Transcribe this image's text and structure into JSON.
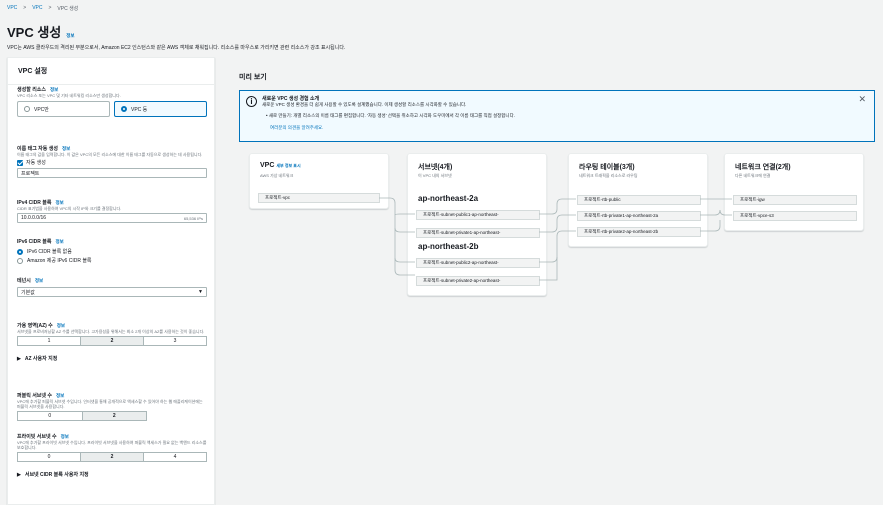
{
  "breadcrumb": {
    "item1": "VPC",
    "sep": ">",
    "item2": "VPC",
    "item3": "VPC 생성"
  },
  "page": {
    "title": "VPC 생성",
    "info": "정보",
    "description": "VPC는 AWS 클라우드의 격리된 부분으로서, Amazon EC2 인스턴스와 같은 AWS 객체로 채워집니다. 리소스를 마우스로 가리키면 관련 리소스가 강조 표시됩니다."
  },
  "settings": {
    "header": "VPC 설정",
    "resources": {
      "label": "생성할 리소스",
      "info": "정보",
      "sub": "VPC 리소스 또는 VPC 및 기타 네트워킹 리소스만 생성합니다.",
      "opt1": "VPC만",
      "opt2": "VPC 등"
    },
    "nametag": {
      "label": "이름 태그 자동 생성",
      "info": "정보",
      "sub": "이름 태그의 값을 입력합니다. 이 값은 VPC의 모든 리소스에 대한 이름 태그를 자동으로 생성하는 데 사용됩니다.",
      "check_label": "자동 생성",
      "value": "프로젝트"
    },
    "ipv4": {
      "label": "IPv4 CIDR 블록",
      "info": "정보",
      "sub": "CIDR 표기법을 사용하여 VPC의 시작 IP와 크기를 결정합니다.",
      "value": "10.0.0.0/16",
      "count": "65,536 IPs"
    },
    "ipv6": {
      "label": "IPv6 CIDR 블록",
      "info": "정보",
      "opt1": "IPv6 CIDR 블록 없음",
      "opt2": "Amazon 제공 IPv6 CIDR 블록"
    },
    "tenancy": {
      "label": "테넌시",
      "info": "정보",
      "value": "기본값"
    },
    "az": {
      "label": "가용 영역(AZ) 수",
      "info": "정보",
      "sub": "서브넷을 프로비저닝할 AZ 수를 선택합니다. 고가용성을 위해서는 최소 2개 이상의 AZ를 사용하는 것이 좋습니다.",
      "options": [
        "1",
        "2",
        "3"
      ],
      "expander": "AZ 사용자 지정"
    },
    "public": {
      "label": "퍼블릭 서브넷 수",
      "info": "정보",
      "sub": "VPC에 추가할 퍼블릭 서브넷 수입니다. 인터넷을 통해 공개적으로 액세스할 수 있어야 하는 웹 애플리케이션에는 퍼블릭 서브넷을 사용합니다.",
      "options": [
        "0",
        "2"
      ]
    },
    "private": {
      "label": "프라이빗 서브넷 수",
      "info": "정보",
      "sub": "VPC에 추가할 프라이빗 서브넷 수입니다. 프라이빗 서브넷을 사용하여 퍼블릭 액세스가 필요 없는 백엔드 리소스를 보호합니다.",
      "options": [
        "0",
        "2",
        "4"
      ],
      "expander": "서브넷 CIDR 블록 사용자 지정"
    }
  },
  "preview": {
    "title": "미리 보기",
    "alert": {
      "title": "새로운 VPC 생성 경험 소개",
      "body": "새로운 VPC 생성 환경을 더 쉽게 사용할 수 있도록 설계했습니다. 이제 생성할 리소스를 시각화할 수 있습니다.",
      "bullet": "새로 만들기: 개별 리소스의 이름 태그를 편집합니다. '자동 생성' 선택을 취소하고 시각화 도우미에서 각 이름 태그를 직접 설정합니다.",
      "link": "여러분의 의견을 알려주세요."
    },
    "vpc": {
      "title": "VPC",
      "title_link": "세부 정보 표시",
      "sub": "AWS 가상 네트워크",
      "node": "프로젝트-vpc"
    },
    "subnets": {
      "title": "서브넷(4개)",
      "sub": "이 VPC 내의 서브넷",
      "az1": "ap-northeast-2a",
      "az2": "ap-northeast-2b",
      "nodes": [
        "프로젝트-subnet-public1-ap-northeast-",
        "프로젝트-subnet-private1-ap-northeast-",
        "프로젝트-subnet-public2-ap-northeast-",
        "프로젝트-subnet-private2-ap-northeast-"
      ]
    },
    "routes": {
      "title": "라우팅 테이블(3개)",
      "sub": "네트워크 트래픽을 리소스로 라우팅",
      "nodes": [
        "프로젝트-rtb-public",
        "프로젝트-rtb-private1-ap-northeast-2a",
        "프로젝트-rtb-private2-ap-northeast-2b"
      ]
    },
    "connections": {
      "title": "네트워크 연결(2개)",
      "sub": "다른 네트워크에 연결",
      "nodes": [
        "프로젝트-igw",
        "프로젝트-vpce-s3"
      ]
    }
  }
}
